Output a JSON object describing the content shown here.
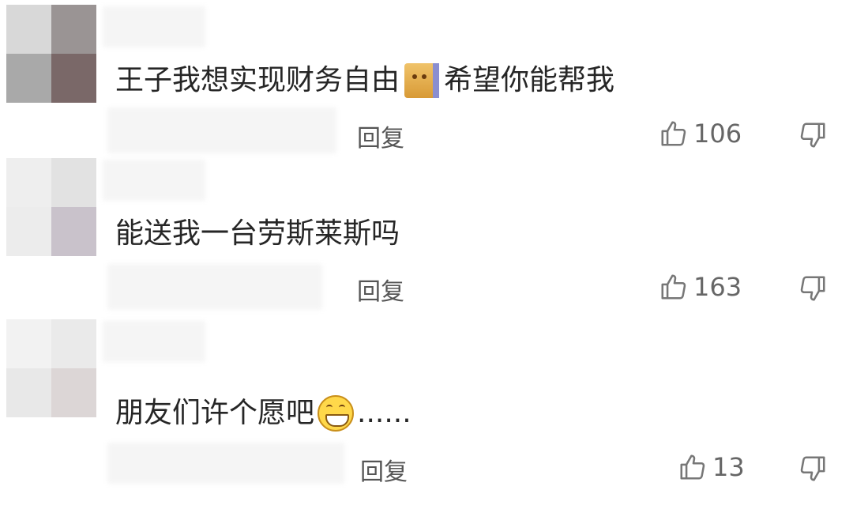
{
  "comments": [
    {
      "text_before": "王子我想实现财务自由",
      "emoji": "cat-emoji",
      "text_after": "希望你能帮我",
      "reply_label": "回复",
      "likes": "106"
    },
    {
      "text_before": "能送我一台劳斯莱斯吗",
      "reply_label": "回复",
      "likes": "163"
    },
    {
      "text_before": "朋友们许个愿吧",
      "emoji": "grinning-emoji",
      "text_after": "......",
      "reply_label": "回复",
      "likes": "13"
    }
  ],
  "icons": {
    "like": "thumbs-up-icon",
    "dislike": "thumbs-down-icon"
  },
  "colors": {
    "text": "#262626",
    "meta": "#666666",
    "background": "#ffffff"
  }
}
